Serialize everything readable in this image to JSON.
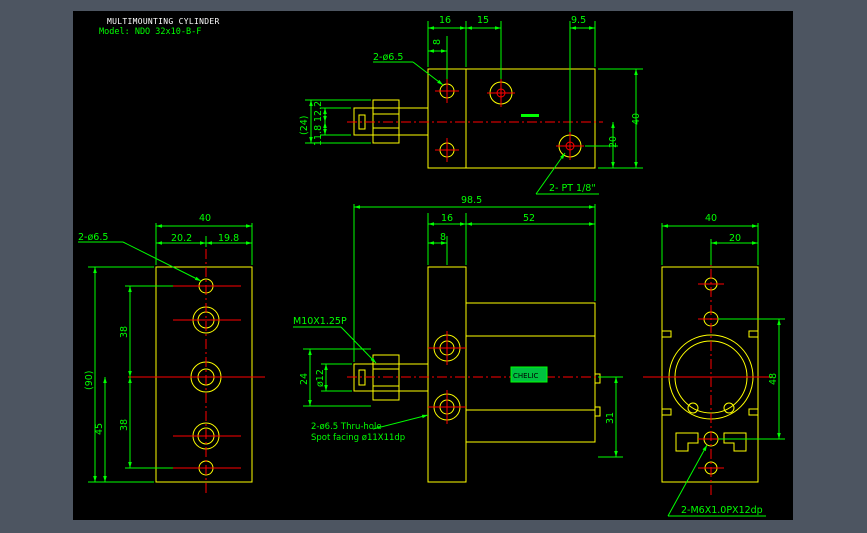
{
  "drawing": {
    "title": "MULTIMOUNTING CYLINDER",
    "model": "Model: NDO 32x10-B-F"
  },
  "colors": {
    "background": "#000000",
    "frame": "#4d5561",
    "outline": "#ffff00",
    "dimension": "#00ff00",
    "centerline": "#ff0000",
    "title": "#ffffff"
  },
  "top_view": {
    "dims": {
      "d16": "16",
      "d15": "15",
      "d9_5": "9.5",
      "d8": "8",
      "hole": "2-ø6.5",
      "d24": "(24)",
      "d12_2": "12.2",
      "d11_8": "11.8",
      "d40": "40",
      "d20": "20",
      "port": "2- PT 1/8\""
    }
  },
  "side_view": {
    "dims": {
      "hole": "2-ø6.5",
      "d40": "40",
      "d20_2": "20.2",
      "d19_8": "19.8",
      "d38a": "38",
      "d38b": "38",
      "d90": "(90)",
      "d45": "45"
    }
  },
  "front_view": {
    "dims": {
      "d98_5": "98.5",
      "d16": "16",
      "d52": "52",
      "d8": "8",
      "thread": "M10X1.25P",
      "d24": "24",
      "phi12": "ø12",
      "hole": "2-ø6.5 Thru-hole",
      "spot": "Spot facing  ø11X11dp",
      "d31": "31",
      "badge": "CHELIC"
    }
  },
  "end_view": {
    "dims": {
      "d40": "40",
      "d20": "20",
      "d48": "48",
      "tap": "2-M6X1.0PX12dp"
    }
  }
}
